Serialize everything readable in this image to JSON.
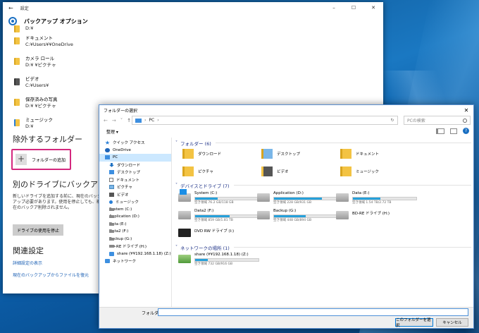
{
  "settings": {
    "title": "設定",
    "header": "バックアップ オプション",
    "folders": [
      {
        "name": "",
        "path": "D:¥"
      },
      {
        "name": "ドキュメント",
        "path": "C:¥Users¥¥OneDrive"
      },
      {
        "name": "カメラ ロール",
        "path": "D:¥ ¥ピクチャ"
      },
      {
        "name": "ビデオ",
        "path": "C:¥Users¥"
      },
      {
        "name": "保存済みの写真",
        "path": "D:¥ ¥ピクチャ"
      },
      {
        "name": "ミュージック",
        "path": "D:¥"
      }
    ],
    "exclude_heading": "除外するフォルダー",
    "add_folder_label": "フォルダーの追加",
    "other_drive_heading": "別のドライブにバックアップ",
    "other_drive_desc": "新しいドライブを追加する前に、現在のバックアップ必要があります。使用を停止しても、現在のバックア削除されません。",
    "stop_button": "ドライブの使用を停止",
    "related_heading": "関連設定",
    "link_details": "詳細設定の表示",
    "link_restore": "現在のバックアップからファイルを復元"
  },
  "dialog": {
    "title": "フォルダーの選択",
    "address": "PC",
    "search_placeholder": "PCの検索",
    "organize": "整理 ▾",
    "nav": [
      {
        "label": "クイック アクセス",
        "icon": "star-icon",
        "level": 1
      },
      {
        "label": "OneDrive",
        "icon": "cloud-icon",
        "level": 1
      },
      {
        "label": "PC",
        "icon": "pc-icon",
        "level": 1,
        "selected": true
      },
      {
        "label": "ダウンロード",
        "icon": "download-icon",
        "level": 2
      },
      {
        "label": "デスクトップ",
        "icon": "folder-icon",
        "level": 2
      },
      {
        "label": "ドキュメント",
        "icon": "document-icon",
        "level": 2
      },
      {
        "label": "ピクチャ",
        "icon": "picture-icon",
        "level": 2
      },
      {
        "label": "ビデオ",
        "icon": "video-icon",
        "level": 2
      },
      {
        "label": "ミュージック",
        "icon": "music-icon",
        "level": 2
      },
      {
        "label": "System (C:)",
        "icon": "drive-icon",
        "level": 2
      },
      {
        "label": "Application (D:)",
        "icon": "drive-icon",
        "level": 2
      },
      {
        "label": "Data (E:)",
        "icon": "drive-icon",
        "level": 2
      },
      {
        "label": "Data2 (F:)",
        "icon": "drive-icon",
        "level": 2
      },
      {
        "label": "Backup (G:)",
        "icon": "drive-icon",
        "level": 2
      },
      {
        "label": "BD-RE ドライブ (H:)",
        "icon": "drive-icon",
        "level": 2
      },
      {
        "label": "share (¥¥192.168.1.18) (Z:)",
        "icon": "network-drive-icon",
        "level": 2
      },
      {
        "label": "ネットワーク",
        "icon": "network-icon",
        "level": 1
      }
    ],
    "group_folders": "フォルダー (6)",
    "folders": [
      "ダウンロード",
      "デスクトップ",
      "ドキュメント",
      "ピクチャ",
      "ビデオ",
      "ミュージック"
    ],
    "group_drives": "デバイスとドライブ (7)",
    "drives": [
      {
        "name": "System (C:)",
        "free": "空き領域 76.2 GB/118 GB",
        "used_fraction": 0.35
      },
      {
        "name": "Application (D:)",
        "free": "空き領域 228 GB/931 GB",
        "used_fraction": 0.75
      },
      {
        "name": "Data (E:)",
        "free": "空き領域 1.54 TB/2.72 TB",
        "used_fraction": 0.43
      },
      {
        "name": "Data2 (F:)",
        "free": "空き領域 859 GB/1.81 TB",
        "used_fraction": 0.54
      },
      {
        "name": "Backup (G:)",
        "free": "空き領域 448 GB/894 GB",
        "used_fraction": 0.5
      },
      {
        "name": "BD-RE ドライブ (H:)",
        "free": "",
        "used_fraction": null
      },
      {
        "name": "DVD RW ドライブ (I:)",
        "free": "",
        "used_fraction": null
      }
    ],
    "group_network": "ネットワークの場所 (1)",
    "network": [
      {
        "name": "share (¥¥192.168.1.18) (Z:)",
        "free": "空き領域 732 GB/916 GB",
        "used_fraction": 0.2
      }
    ],
    "folder_label": "フォルダー:",
    "ok_button": "このフォルダーを選択",
    "cancel_button": "キャンセル"
  }
}
